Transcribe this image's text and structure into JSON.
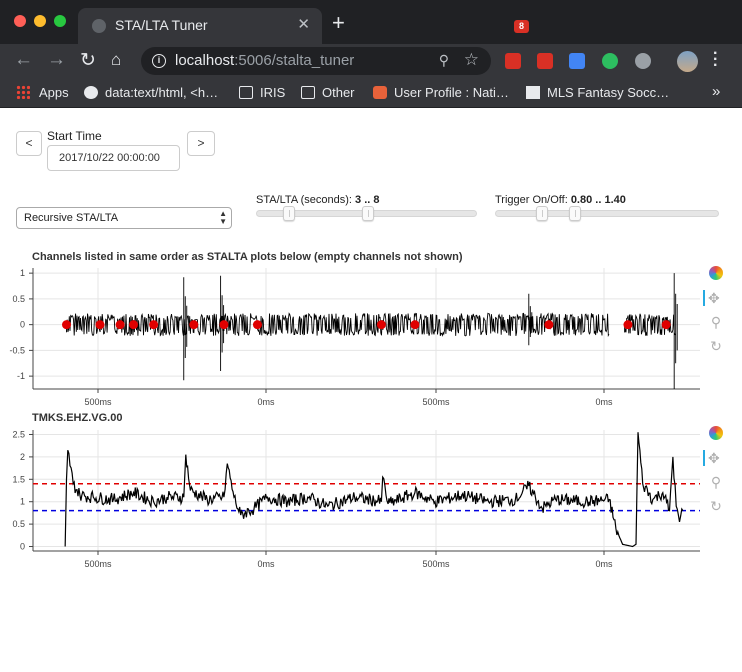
{
  "browser": {
    "tab_title": "STA/LTA Tuner",
    "tab_close": "✕",
    "new_tab": "+",
    "url_host": "localhost",
    "url_path": ":5006/stalta_tuner",
    "extension_badge": "8",
    "bookmarks": [
      "Apps",
      "data:text/html, <h…",
      "IRIS",
      "Other",
      "User Profile : Nati…",
      "MLS Fantasy Socc…"
    ],
    "bookmarks_overflow": "»"
  },
  "controls": {
    "prev_label": "<",
    "next_label": ">",
    "start_time_label": "Start Time",
    "start_time_value": "2017/10/22 00:00:00",
    "algorithm_value": "Recursive STA/LTA",
    "stalta_label": "STA/LTA (seconds):",
    "stalta_value": "3 .. 8",
    "stalta_range": [
      3,
      8
    ],
    "trigger_label": "Trigger On/Off:",
    "trigger_value": "0.80 .. 1.40",
    "trigger_range": [
      0.8,
      1.4
    ]
  },
  "colors": {
    "trace": "#000000",
    "marker": "#e00000",
    "trigger_on": "#e00000",
    "trigger_off": "#0000e0",
    "grid": "#e5e5e5"
  },
  "plots": {
    "waveform_title": "Channels listed in same order as STALTA plots below (empty channels not shown)",
    "stalta_title": "TMKS.EHZ.VG.00"
  },
  "chart_data": [
    {
      "type": "line",
      "title": "Channels listed in same order as STALTA plots below (empty channels not shown)",
      "xlabel": "",
      "ylabel": "",
      "x_tick_labels": [
        "500ms",
        "0ms",
        "500ms",
        "0ms"
      ],
      "y_ticks": [
        1,
        0.5,
        0,
        -0.5,
        -1
      ],
      "ylim": [
        -1.25,
        1.1
      ],
      "grid": true,
      "series": [
        {
          "kind": "waveform",
          "segments": [
            [
              0.05,
              0.86
            ],
            [
              0.883,
              0.96
            ]
          ],
          "spikes": [
            [
              0.225,
              0.92,
              -1.08
            ],
            [
              0.28,
              0.95,
              -0.9
            ],
            [
              0.74,
              0.6,
              -0.4
            ],
            [
              0.957,
              1.0,
              -1.25
            ]
          ]
        },
        {
          "kind": "trigger_markers",
          "positions": [
            0.05,
            0.1,
            0.13,
            0.15,
            0.18,
            0.24,
            0.285,
            0.335,
            0.52,
            0.57,
            0.77,
            0.888,
            0.945
          ],
          "y": 0
        }
      ]
    },
    {
      "type": "line",
      "title": "TMKS.EHZ.VG.00",
      "xlabel": "",
      "ylabel": "",
      "x_tick_labels": [
        "500ms",
        "0ms",
        "500ms",
        "0ms"
      ],
      "y_ticks": [
        2.5,
        2,
        1.5,
        1,
        0.5,
        0
      ],
      "ylim": [
        -0.1,
        2.6
      ],
      "grid": true,
      "trigger_on": 1.4,
      "trigger_off": 0.8,
      "series": [
        {
          "kind": "stalta",
          "points": [
            [
              0.048,
              0.0
            ],
            [
              0.05,
              1.5
            ],
            [
              0.052,
              2.15
            ],
            [
              0.06,
              1.4
            ],
            [
              0.07,
              1.15
            ],
            [
              0.09,
              1.1
            ],
            [
              0.12,
              1.05
            ],
            [
              0.15,
              1.2
            ],
            [
              0.18,
              1.0
            ],
            [
              0.2,
              1.1
            ],
            [
              0.225,
              1.1
            ],
            [
              0.228,
              2.05
            ],
            [
              0.235,
              1.25
            ],
            [
              0.26,
              1.05
            ],
            [
              0.285,
              1.1
            ],
            [
              0.29,
              1.85
            ],
            [
              0.3,
              1.1
            ],
            [
              0.31,
              0.7
            ],
            [
              0.33,
              0.85
            ],
            [
              0.35,
              1.1
            ],
            [
              0.38,
              1.0
            ],
            [
              0.41,
              1.1
            ],
            [
              0.44,
              0.9
            ],
            [
              0.48,
              1.1
            ],
            [
              0.52,
              1.0
            ],
            [
              0.522,
              1.55
            ],
            [
              0.53,
              0.95
            ],
            [
              0.57,
              1.2
            ],
            [
              0.6,
              1.0
            ],
            [
              0.64,
              1.15
            ],
            [
              0.68,
              1.0
            ],
            [
              0.72,
              1.05
            ],
            [
              0.74,
              1.35
            ],
            [
              0.76,
              0.85
            ],
            [
              0.78,
              1.05
            ],
            [
              0.83,
              1.0
            ],
            [
              0.86,
              1.05
            ],
            [
              0.87,
              0.4
            ],
            [
              0.88,
              0.05
            ],
            [
              0.895,
              0.0
            ],
            [
              0.9,
              0.05
            ],
            [
              0.903,
              2.55
            ],
            [
              0.91,
              1.4
            ],
            [
              0.925,
              1.05
            ],
            [
              0.94,
              1.2
            ],
            [
              0.95,
              0.8
            ],
            [
              0.955,
              2.0
            ],
            [
              0.96,
              0.9
            ],
            [
              0.965,
              0.55
            ],
            [
              0.97,
              0.8
            ]
          ]
        }
      ]
    }
  ]
}
